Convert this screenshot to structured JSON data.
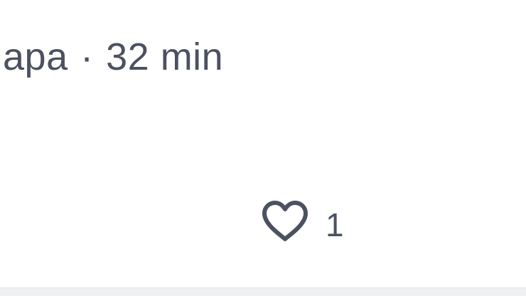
{
  "post_meta": {
    "author_fragment": "apa",
    "separator": "·",
    "time_ago": "32 min"
  },
  "actions": {
    "like_icon": "heart-icon",
    "like_count": "1"
  },
  "colors": {
    "text_muted": "#4b5160",
    "divider": "#eef0f2"
  }
}
